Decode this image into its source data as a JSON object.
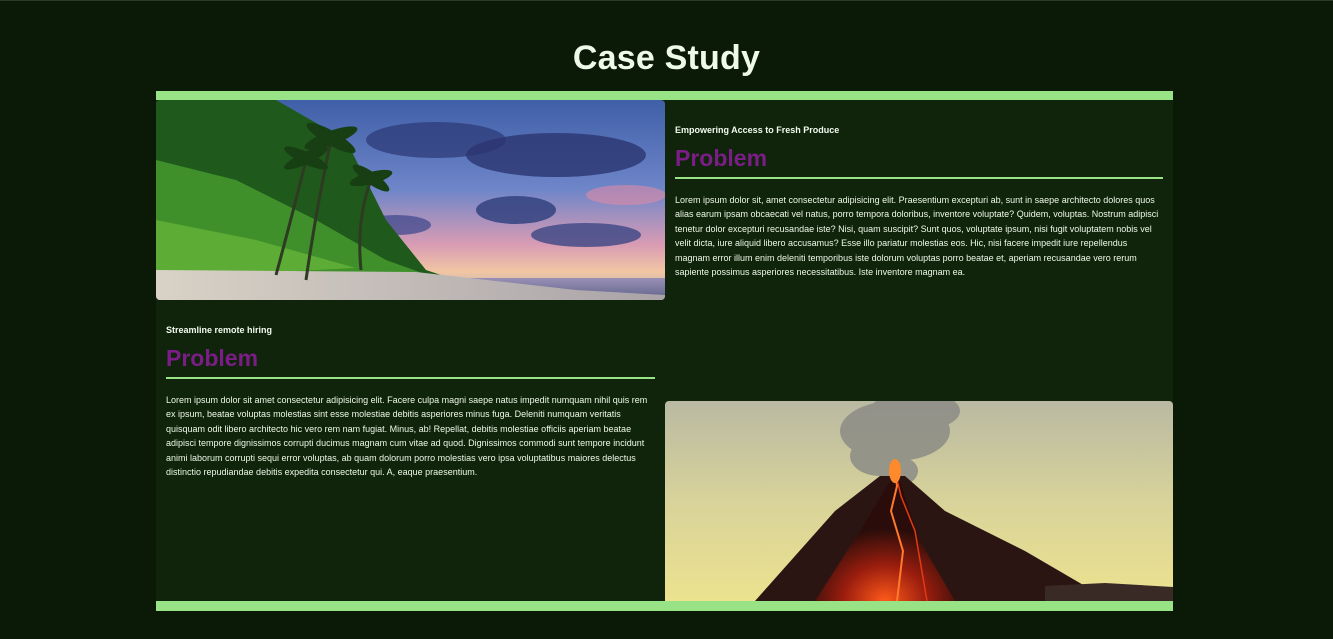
{
  "page": {
    "title": "Case Study"
  },
  "cases": [
    {
      "image": "tropical-beach-sunset-image",
      "subtitle": "Empowering Access to Fresh Produce",
      "heading": "Problem",
      "body": "Lorem ipsum dolor sit, amet consectetur adipisicing elit. Praesentium excepturi ab, sunt in saepe architecto dolores quos alias earum ipsam obcaecati vel natus, porro tempora doloribus, inventore voluptate? Quidem, voluptas. Nostrum adipisci tenetur dolor excepturi recusandae iste? Nisi, quam suscipit? Sunt quos, voluptate ipsum, nisi fugit voluptatem nobis vel velit dicta, iure aliquid libero accusamus? Esse illo pariatur molestias eos. Hic, nisi facere impedit iure repellendus magnam error illum enim deleniti temporibus iste dolorum voluptas porro beatae et, aperiam recusandae vero rerum sapiente possimus asperiores necessitatibus. Iste inventore magnam ea."
    },
    {
      "image": "erupting-volcano-image",
      "subtitle": "Streamline remote hiring",
      "heading": "Problem",
      "body": "Lorem ipsum dolor sit amet consectetur adipisicing elit. Facere culpa magni saepe natus impedit numquam nihil quis rem ex ipsum, beatae voluptas molestias sint esse molestiae debitis asperiores minus fuga. Deleniti numquam veritatis quisquam odit libero architecto hic vero rem nam fugiat. Minus, ab! Repellat, debitis molestiae officiis aperiam beatae adipisci tempore dignissimos corrupti ducimus magnam cum vitae ad quod. Dignissimos commodi sunt tempore incidunt animi laborum corrupti sequi error voluptas, ab quam dolorum porro molestias vero ipsa voluptatibus maiores delectus distinctio repudiandae debitis expedita consectetur qui. A, eaque praesentium."
    }
  ],
  "colors": {
    "background": "#0b1a07",
    "panel": "#0f240b",
    "accent": "#97e386",
    "heading": "#7b1d86",
    "text": "#eef9e9"
  }
}
